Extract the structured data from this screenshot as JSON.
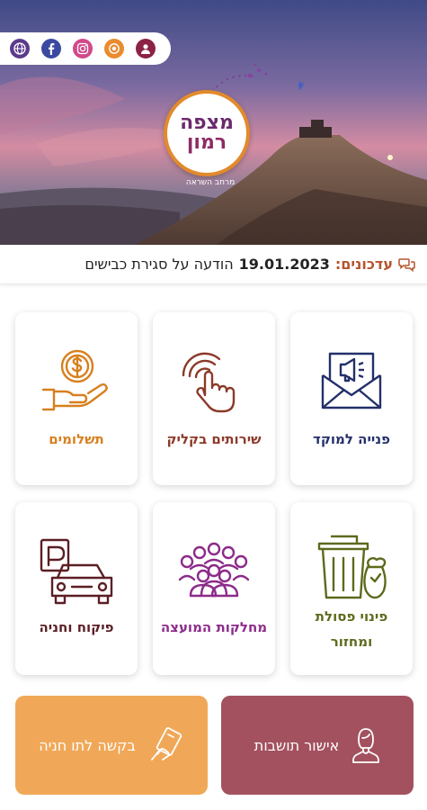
{
  "header": {
    "social": [
      {
        "name": "globe-icon",
        "color": "#5b3a8c"
      },
      {
        "name": "facebook-icon",
        "color": "#3b4aa0"
      },
      {
        "name": "instagram-icon",
        "color": "#d04a8a"
      },
      {
        "name": "ring-icon",
        "color": "#e98b2f"
      },
      {
        "name": "user-icon",
        "color": "#8c2244"
      }
    ],
    "logo": {
      "line1": "מצפה",
      "line2": "רמון",
      "tagline": "מרחב השראה"
    }
  },
  "updates": {
    "label": "עדכונים:",
    "date": "19.01.2023",
    "text": "הודעה על סגירת כבישים"
  },
  "tiles": [
    {
      "id": "call-center",
      "label": "פנייה למוקד",
      "color": "#24306a"
    },
    {
      "id": "click-services",
      "label": "שירותים בקליק",
      "color": "#8b3a2a"
    },
    {
      "id": "payments",
      "label": "תשלומים",
      "color": "#d7801f"
    },
    {
      "id": "waste",
      "label_line1": "פינוי פסולת",
      "label_line2": "ומחזור",
      "color": "#5d6a1c"
    },
    {
      "id": "departments",
      "label": "מחלקות המועצה",
      "color": "#8c2b8a"
    },
    {
      "id": "parking",
      "label": "פיקוח וחניה",
      "color": "#5b1f24"
    }
  ],
  "actions": {
    "residency": {
      "label": "אישור תושבות",
      "color": "#a3515f"
    },
    "parking_permit": {
      "label": "בקשה לתו חניה",
      "color": "#f0a858"
    }
  }
}
